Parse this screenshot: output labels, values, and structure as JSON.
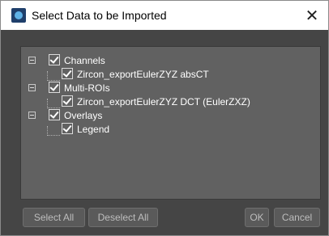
{
  "window": {
    "title": "Select Data to be Imported",
    "close_glyph": "✕"
  },
  "tree": {
    "groups": [
      {
        "label": "Channels",
        "checked": true,
        "children": [
          {
            "label": "Zircon_exportEulerZYZ  absCT",
            "checked": true
          }
        ]
      },
      {
        "label": "Multi-ROIs",
        "checked": true,
        "children": [
          {
            "label": "Zircon_exportEulerZYZ  DCT (EulerZXZ)",
            "checked": true
          }
        ]
      },
      {
        "label": "Overlays",
        "checked": true,
        "children": [
          {
            "label": "Legend",
            "checked": true
          }
        ]
      }
    ]
  },
  "buttons": {
    "select_all": "Select All",
    "deselect_all": "Deselect All",
    "ok": "OK",
    "cancel": "Cancel"
  },
  "icons": {
    "app": "app-logo-icon",
    "close": "close-icon",
    "expander": "collapse-minus-icon",
    "checkbox": "checkbox-checked-icon"
  }
}
